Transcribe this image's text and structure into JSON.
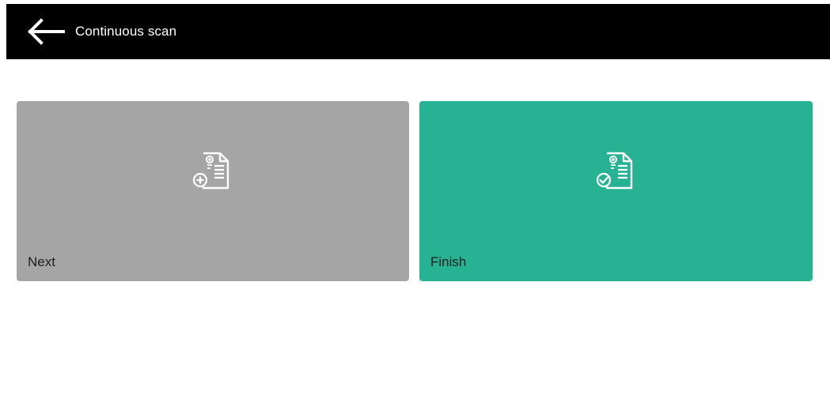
{
  "header": {
    "title": "Continuous scan",
    "back_icon": "arrow-left-icon"
  },
  "actions": {
    "next": {
      "label": "Next",
      "icon": "document-add-icon",
      "color": "#a6a5a5"
    },
    "finish": {
      "label": "Finish",
      "icon": "document-check-icon",
      "color": "#27b393"
    }
  },
  "colors": {
    "header_bg": "#000000",
    "header_text": "#ffffff",
    "background": "#ffffff"
  }
}
